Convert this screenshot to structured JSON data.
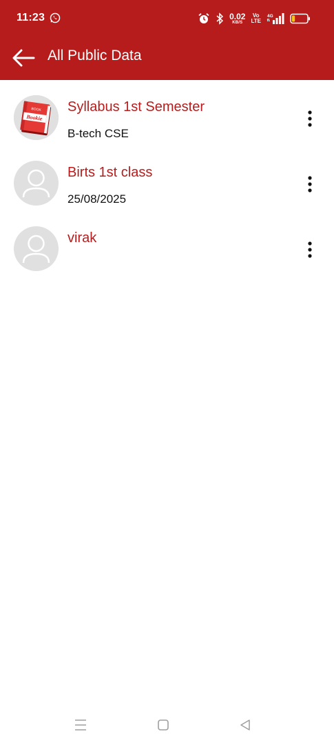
{
  "status_bar": {
    "time": "11:23",
    "net_speed_value": "0.02",
    "net_speed_unit": "KB/S",
    "volte_top": "Vo",
    "volte_bottom": "LTE",
    "network_type": "4G",
    "icons": [
      "whatsapp-icon",
      "alarm-icon",
      "bluetooth-icon",
      "signal-icon",
      "battery-icon"
    ],
    "battery_level": 0.2
  },
  "app_bar": {
    "title": "All Public Data",
    "back_icon": "arrow-left-icon"
  },
  "items": [
    {
      "title": "Syllabus 1st Semester",
      "subtitle": "B-tech CSE",
      "avatar": "book-image"
    },
    {
      "title": "Birts 1st class",
      "subtitle": "25/08/2025",
      "avatar": "person-placeholder-icon"
    },
    {
      "title": "virak",
      "subtitle": "",
      "avatar": "person-placeholder-icon"
    }
  ],
  "book_cover": {
    "top_text": "BOOK",
    "main_text": "Bookie"
  },
  "nav_bar": {
    "icons": [
      "menu-icon",
      "home-square-icon",
      "back-triangle-icon"
    ]
  },
  "colors": {
    "primary": "#b71c1c",
    "avatar_bg": "#e0e0e0",
    "battery_fill": "#f5c518"
  }
}
